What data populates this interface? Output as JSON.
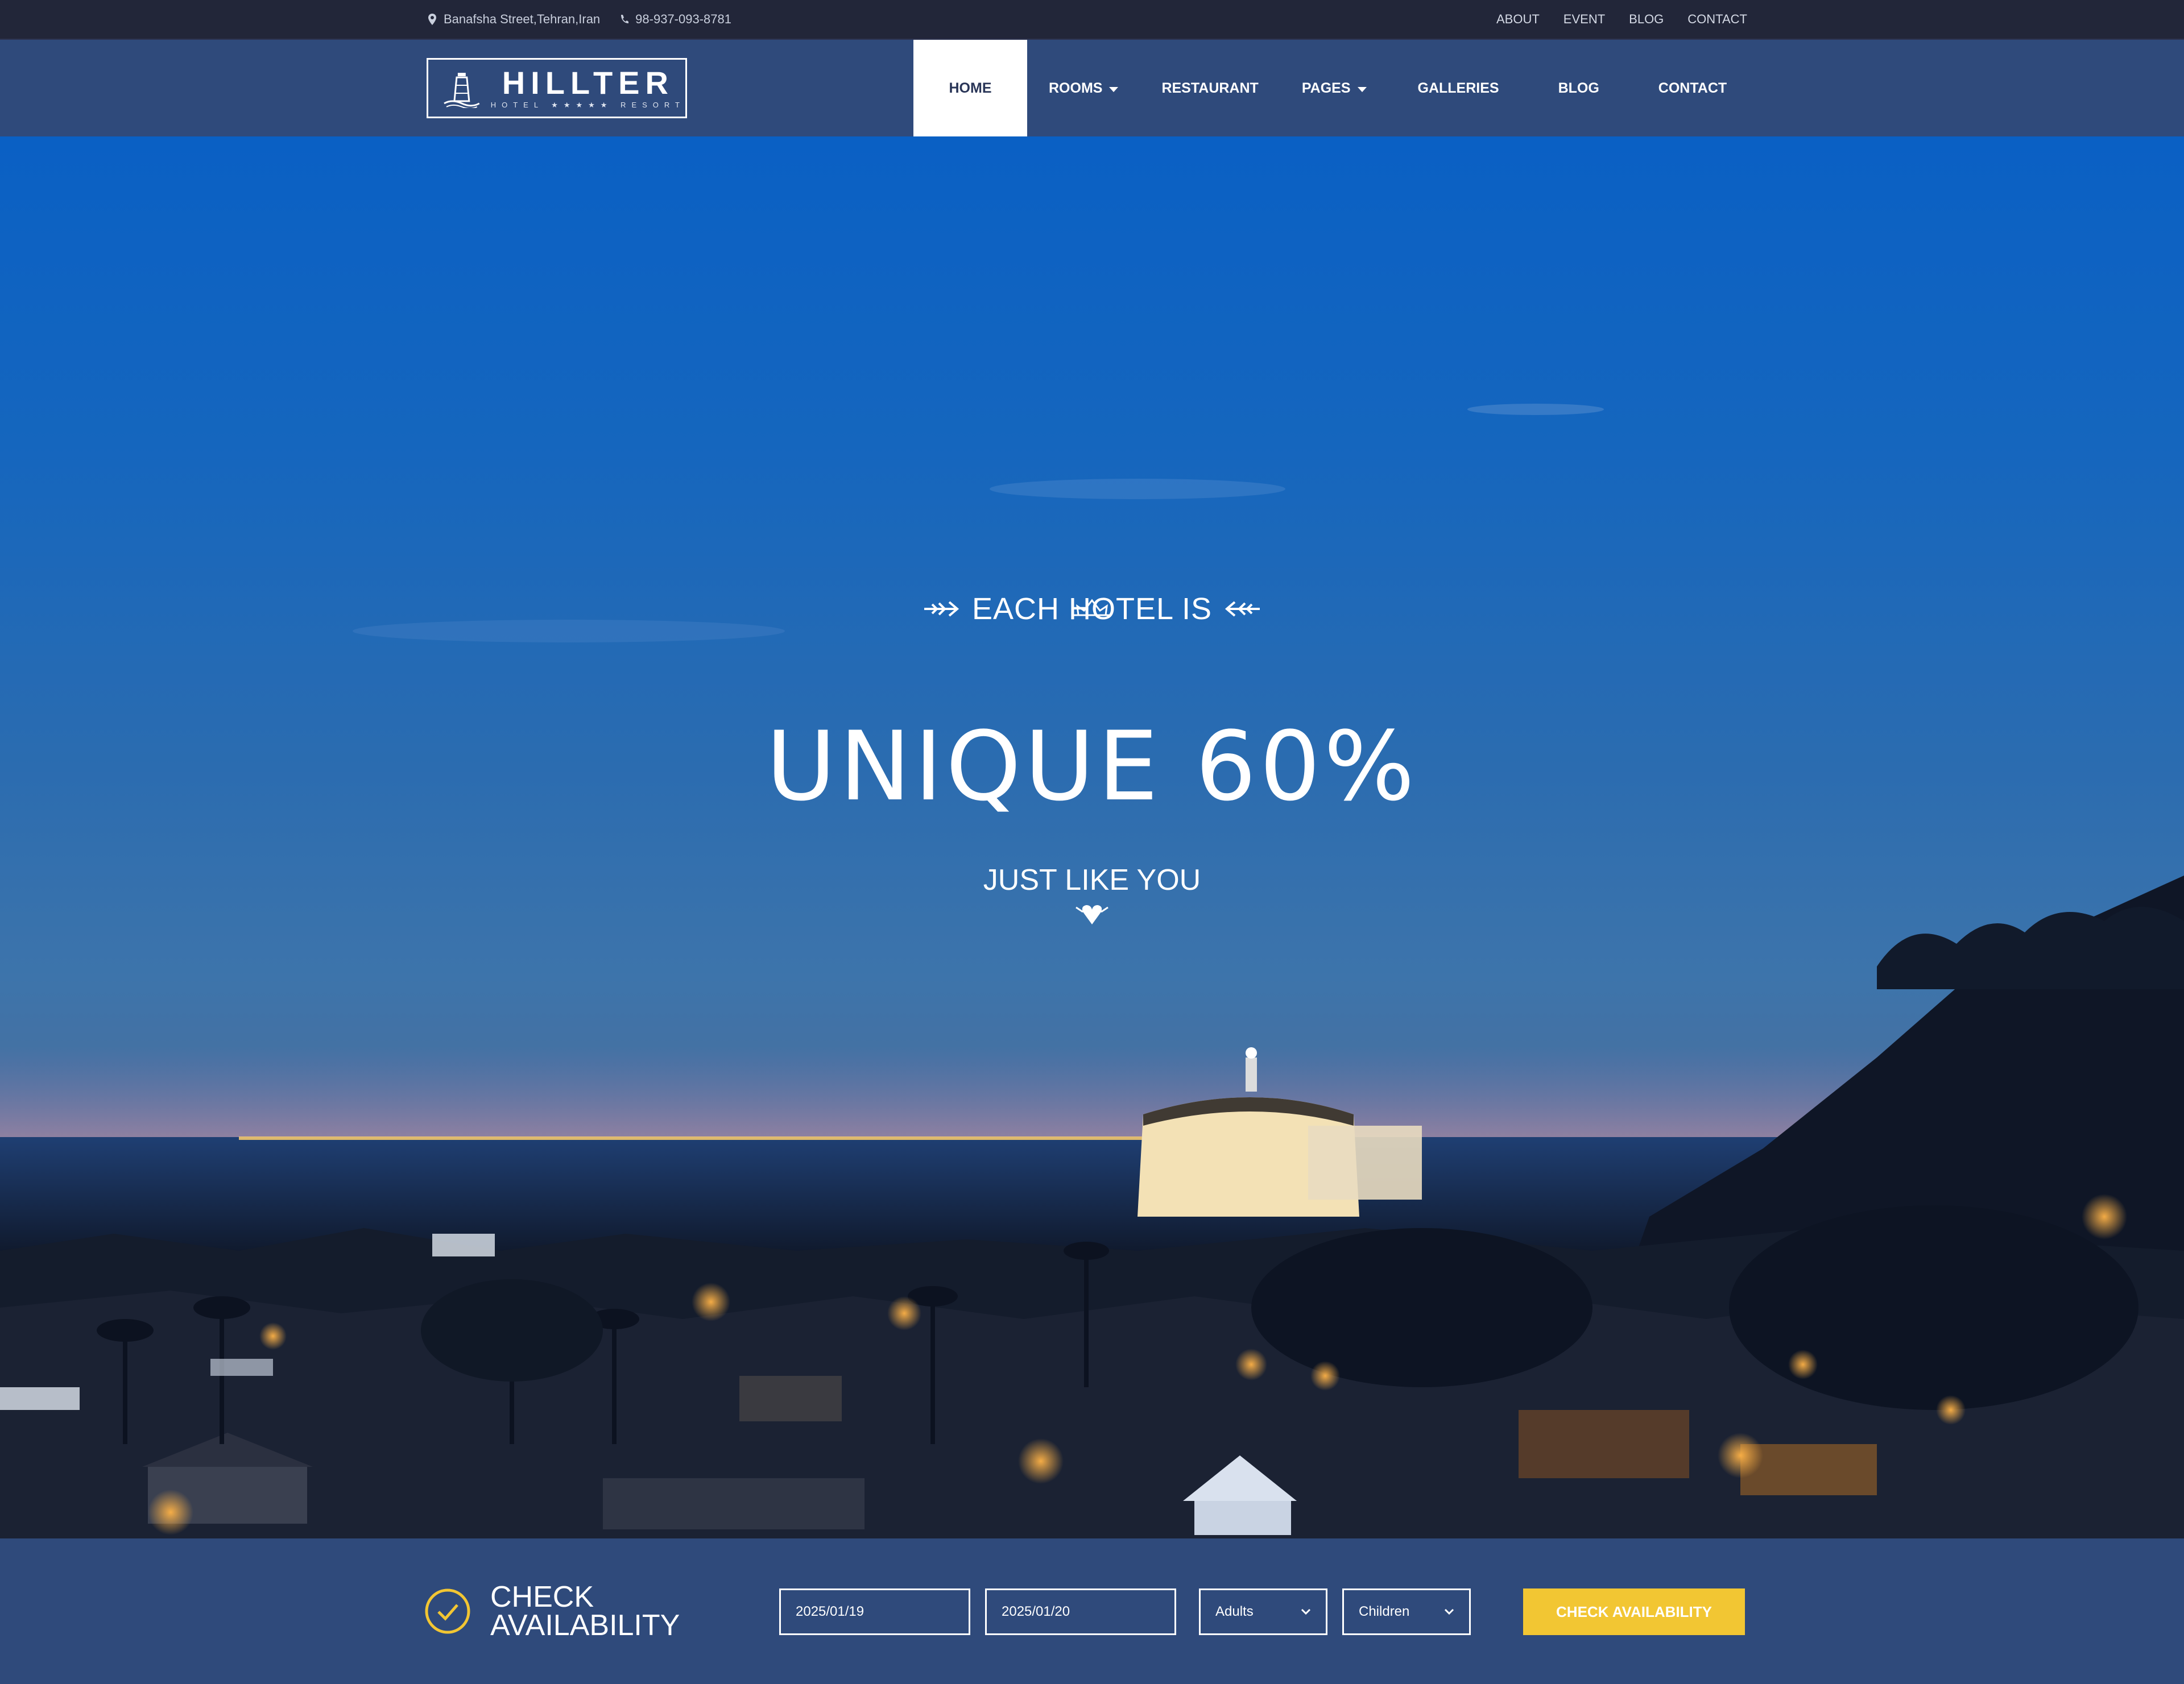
{
  "topbar": {
    "address": "Banafsha Street,Tehran,Iran",
    "phone": "98-937-093-8781",
    "links": [
      "ABOUT",
      "EVENT",
      "BLOG",
      "CONTACT"
    ]
  },
  "logo": {
    "brand": "HILLTER",
    "tagline": "HOTEL ★★★★★ RESORT"
  },
  "nav": {
    "items": [
      {
        "label": "HOME",
        "active": true,
        "dropdown": false
      },
      {
        "label": "ROOMS",
        "active": false,
        "dropdown": true
      },
      {
        "label": "RESTAURANT",
        "active": false,
        "dropdown": false
      },
      {
        "label": "PAGES",
        "active": false,
        "dropdown": true
      },
      {
        "label": "GALLERIES",
        "active": false,
        "dropdown": false
      },
      {
        "label": "BLOG",
        "active": false,
        "dropdown": false
      },
      {
        "label": "CONTACT",
        "active": false,
        "dropdown": false
      }
    ]
  },
  "hero": {
    "eyebrow": "EACH HOTEL IS",
    "headline": "UNIQUE 60%",
    "tagline": "JUST LIKE YOU"
  },
  "booking": {
    "title_line1": "CHECK",
    "title_line2": "AVAILABILITY",
    "arrival": "2025/01/19",
    "departure": "2025/01/20",
    "adults": "Adults",
    "children": "Children",
    "button": "CHECK AVAILABILITY"
  },
  "colors": {
    "topbar": "#222639",
    "nav": "#2f4a7b",
    "accent": "#f2c633",
    "sky": "#1566be"
  },
  "icons": {
    "address": "map-pin-icon",
    "phone": "phone-icon",
    "check": "check-circle-icon",
    "dropdown": "chevron-down-icon"
  }
}
